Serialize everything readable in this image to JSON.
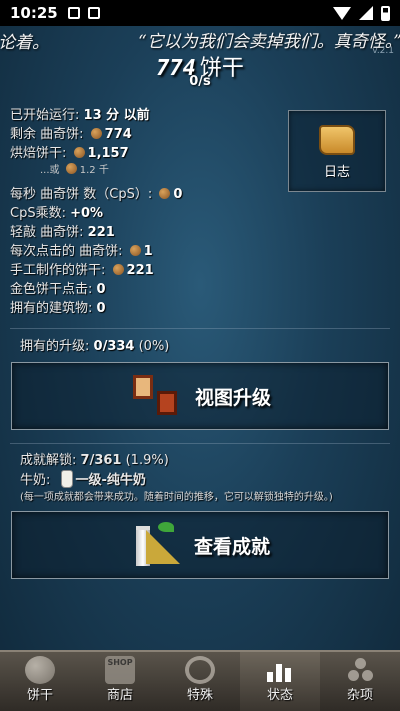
{
  "status_bar": {
    "time": "10:25"
  },
  "ticker": {
    "left_text": "论着。",
    "quote": "“它以为我们会卖掉我们。真奇怪。”",
    "version": "v.2.1"
  },
  "header": {
    "cookie_count": "774",
    "cookie_unit": "饼干",
    "per_second": "0/s"
  },
  "stats": {
    "started": {
      "label": "已开始运行:",
      "value": "13 分 以前"
    },
    "remaining": {
      "label": "剩余 曲奇饼:",
      "value": "774"
    },
    "baked": {
      "label": "烘焙饼干:",
      "value": "1,157"
    },
    "baked_alt": {
      "prefix": "...或",
      "value": "1.2 千"
    },
    "cps": {
      "label": "每秒 曲奇饼 数（CpS）:",
      "value": "0"
    },
    "cps_mult": {
      "label": "CpS乘数:",
      "value": "+0%"
    },
    "tap_cookies": {
      "label": "轻敲 曲奇饼:",
      "value": "221"
    },
    "per_click": {
      "label": "每次点击的 曲奇饼:",
      "value": "1"
    },
    "handmade": {
      "label": "手工制作的饼干:",
      "value": "221"
    },
    "golden_clicks": {
      "label": "金色饼干点击:",
      "value": "0"
    },
    "buildings": {
      "label": "拥有的建筑物:",
      "value": "0"
    }
  },
  "journal_button": {
    "label": "日志",
    "icon": "scroll-icon"
  },
  "upgrades": {
    "label": "拥有的升级:",
    "value": "0/334",
    "percent": "(0%)",
    "button_label": "视图升级"
  },
  "achievements": {
    "label": "成就解锁:",
    "value": "7/361",
    "percent": "(1.9%)",
    "milk_label": "牛奶:",
    "milk_value": "一级-纯牛奶",
    "note": "(每一项成就都会带来成功。随着时间的推移，它可以解锁独特的升级。)",
    "button_label": "查看成就"
  },
  "bottom_nav": {
    "items": [
      {
        "label": "饼干",
        "icon": "cookie-icon"
      },
      {
        "label": "商店",
        "icon": "shop-icon",
        "icon_text": "SHOP"
      },
      {
        "label": "特殊",
        "icon": "special-icon"
      },
      {
        "label": "状态",
        "icon": "stats-icon",
        "active": true
      },
      {
        "label": "杂项",
        "icon": "misc-icon"
      }
    ]
  }
}
